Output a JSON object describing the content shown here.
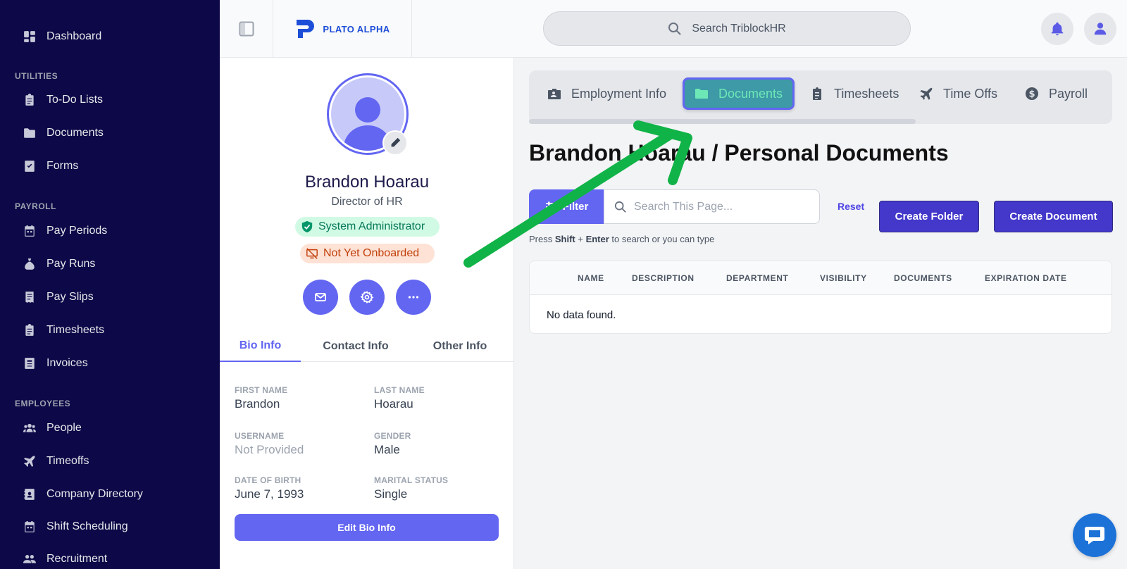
{
  "sidebar": {
    "items": [
      {
        "label": "Dashboard",
        "icon": "dashboard-icon"
      },
      {
        "label": "To-Do Lists",
        "icon": "clipboard-icon"
      },
      {
        "label": "Documents",
        "icon": "folder-icon"
      },
      {
        "label": "Forms",
        "icon": "form-icon"
      },
      {
        "label": "Pay Periods",
        "icon": "calendar-icon"
      },
      {
        "label": "Pay Runs",
        "icon": "money-bag-icon"
      },
      {
        "label": "Pay Slips",
        "icon": "receipt-icon"
      },
      {
        "label": "Timesheets",
        "icon": "clipboard-list-icon"
      },
      {
        "label": "Invoices",
        "icon": "invoice-icon"
      },
      {
        "label": "People",
        "icon": "people-icon"
      },
      {
        "label": "Timeoffs",
        "icon": "plane-icon"
      },
      {
        "label": "Company Directory",
        "icon": "address-book-icon"
      },
      {
        "label": "Shift Scheduling",
        "icon": "calendar-icon"
      },
      {
        "label": "Recruitment",
        "icon": "users-icon"
      }
    ],
    "sections": {
      "utilities": "UTILITIES",
      "payroll": "PAYROLL",
      "employees": "EMPLOYEES"
    }
  },
  "header": {
    "logo_text": "PLATO ALPHA",
    "search_placeholder": "Search TriblockHR"
  },
  "profile": {
    "name": "Brandon Hoarau",
    "title": "Director of HR",
    "badge_admin": "System Administrator",
    "badge_onboard": "Not Yet Onboarded",
    "tabs": [
      {
        "label": "Bio Info"
      },
      {
        "label": "Contact Info"
      },
      {
        "label": "Other Info"
      }
    ],
    "fields": {
      "first_name_label": "FIRST NAME",
      "first_name": "Brandon",
      "last_name_label": "LAST NAME",
      "last_name": "Hoarau",
      "username_label": "USERNAME",
      "username": "Not Provided",
      "gender_label": "GENDER",
      "gender": "Male",
      "dob_label": "DATE OF BIRTH",
      "dob": "June 7, 1993",
      "marital_label": "MARITAL STATUS",
      "marital": "Single"
    },
    "edit_button": "Edit Bio Info"
  },
  "main": {
    "tabs": [
      {
        "label": "Employment Info"
      },
      {
        "label": "Documents"
      },
      {
        "label": "Timesheets"
      },
      {
        "label": "Time Offs"
      },
      {
        "label": "Payroll"
      }
    ],
    "heading": "Brandon Hoarau / Personal Documents",
    "filter_label": "Filter",
    "search_placeholder": "Search This Page...",
    "reset_label": "Reset",
    "create_folder": "Create Folder",
    "create_document": "Create Document",
    "hint": {
      "pre": "Press ",
      "key1": "Shift",
      "plus": " + ",
      "key2": "Enter",
      "post": " to search or you can type"
    },
    "table": {
      "columns": [
        "NAME",
        "DESCRIPTION",
        "DEPARTMENT",
        "VISIBILITY",
        "DOCUMENTS",
        "EXPIRATION DATE"
      ],
      "empty_text": "No data found."
    }
  },
  "colors": {
    "sidebar_bg": "#0d0847",
    "accent": "#6366f1",
    "annotation_arrow": "#10b347"
  }
}
